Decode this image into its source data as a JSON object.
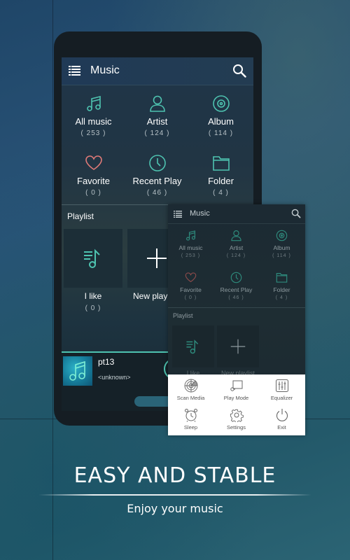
{
  "app": {
    "title": "Music",
    "categories": [
      {
        "label": "All music",
        "count": "( 253 )",
        "icon": "music-note-icon"
      },
      {
        "label": "Artist",
        "count": "( 124 )",
        "icon": "person-icon"
      },
      {
        "label": "Album",
        "count": "( 114 )",
        "icon": "disc-icon"
      },
      {
        "label": "Favorite",
        "count": "( 0 )",
        "icon": "heart-icon"
      },
      {
        "label": "Recent Play",
        "count": "( 46 )",
        "icon": "clock-icon"
      },
      {
        "label": "Folder",
        "count": "( 4 )",
        "icon": "folder-icon"
      }
    ],
    "playlist": {
      "title": "Playlist",
      "items": [
        {
          "label": "I like",
          "count": "( 0 )"
        },
        {
          "label": "New play"
        }
      ]
    },
    "now_playing": {
      "title": "pt13",
      "artist": "<unknown>"
    }
  },
  "overlay": {
    "title": "Music",
    "categories": [
      {
        "label": "All music",
        "count": "( 253 )"
      },
      {
        "label": "Artist",
        "count": "( 124 )"
      },
      {
        "label": "Album",
        "count": "( 114 )"
      },
      {
        "label": "Favorite",
        "count": "( 0 )"
      },
      {
        "label": "Recent Play",
        "count": "( 46 )"
      },
      {
        "label": "Folder",
        "count": "( 4 )"
      }
    ],
    "playlist_title": "Playlist",
    "playlist_items": [
      "I like",
      "New playlist"
    ],
    "menu": [
      {
        "label": "Scan Media",
        "icon": "radar-icon"
      },
      {
        "label": "Play Mode",
        "icon": "play-mode-icon"
      },
      {
        "label": "Equalizer",
        "icon": "equalizer-icon"
      },
      {
        "label": "Sleep",
        "icon": "alarm-clock-icon"
      },
      {
        "label": "Settings",
        "icon": "gear-icon"
      },
      {
        "label": "Exit",
        "icon": "power-icon"
      }
    ]
  },
  "promo": {
    "headline": "EASY AND STABLE",
    "subline": "Enjoy your music"
  },
  "colors": {
    "accent": "#4ec3b0",
    "favorite": "#e07a78",
    "background": "#24506a"
  }
}
